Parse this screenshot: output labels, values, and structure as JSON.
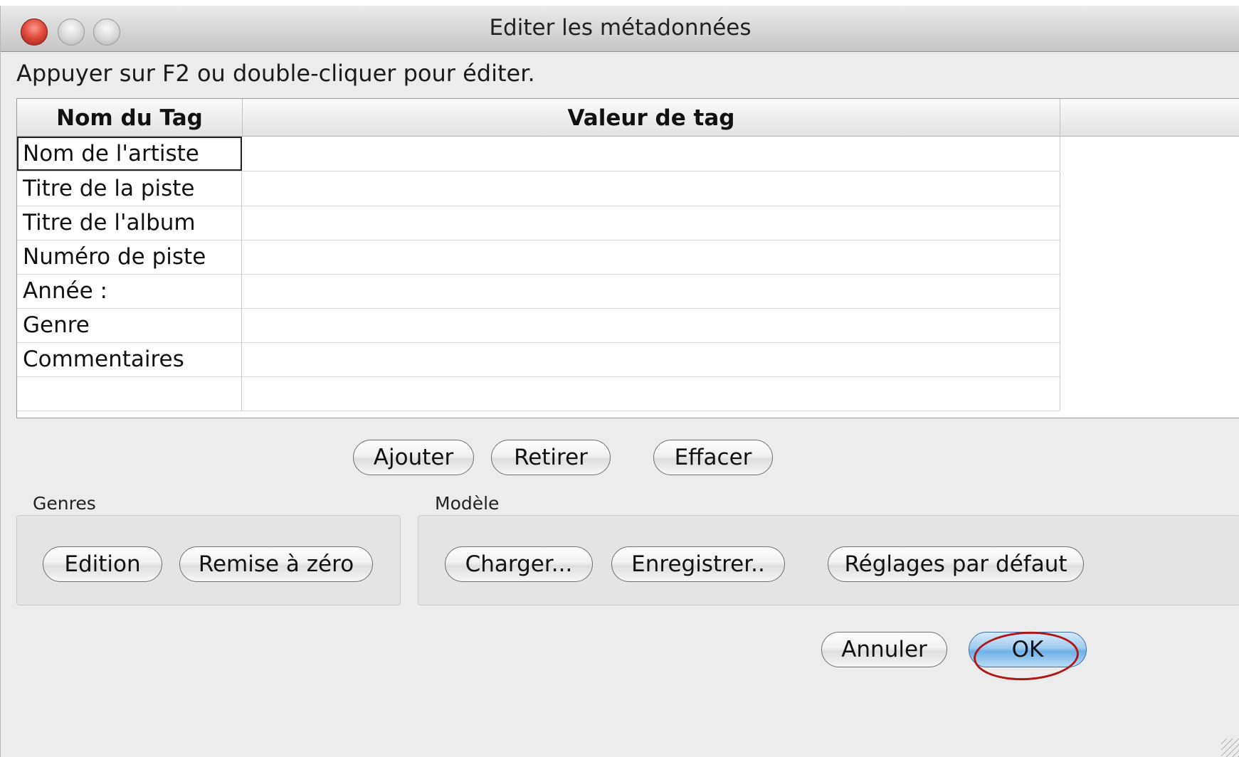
{
  "window": {
    "title": "Editer les métadonnées",
    "instruction": "Appuyer sur F2 ou double-cliquer pour éditer."
  },
  "table": {
    "headers": [
      "Nom du  Tag",
      "Valeur de tag"
    ],
    "rows": [
      {
        "name": "Nom de l'artiste",
        "value": ""
      },
      {
        "name": "Titre de la piste",
        "value": ""
      },
      {
        "name": "Titre de l'album",
        "value": ""
      },
      {
        "name": "Numéro de piste",
        "value": ""
      },
      {
        "name": "Année :",
        "value": ""
      },
      {
        "name": "Genre",
        "value": ""
      },
      {
        "name": "Commentaires",
        "value": ""
      },
      {
        "name": "",
        "value": ""
      }
    ]
  },
  "table_actions": {
    "add": "Ajouter",
    "remove": "Retirer",
    "clear": "Effacer"
  },
  "genres": {
    "label": "Genres",
    "edit": "Edition",
    "reset": "Remise à zéro"
  },
  "model": {
    "label": "Modèle",
    "load": "Charger...",
    "save": "Enregistrer..",
    "defaults": "Réglages par défaut"
  },
  "dialog": {
    "cancel": "Annuler",
    "ok": "OK"
  },
  "colors": {
    "highlight_circle": "#b01818",
    "default_button": "#6fb0e6"
  }
}
